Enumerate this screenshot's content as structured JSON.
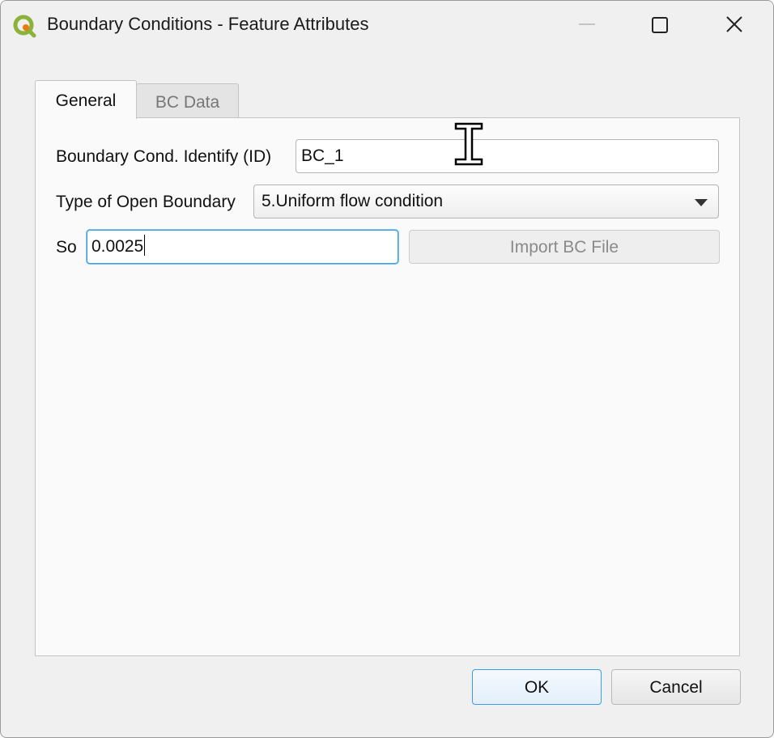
{
  "window": {
    "title": "Boundary Conditions - Feature Attributes",
    "app_icon": "qgis-logo-icon",
    "controls": {
      "minimize": "minimize-icon",
      "maximize": "maximize-icon",
      "close": "close-icon"
    }
  },
  "tabs": [
    {
      "label": "General",
      "active": true
    },
    {
      "label": "BC Data",
      "active": false
    }
  ],
  "form": {
    "id_label": "Boundary Cond. Identify (ID)",
    "id_value": "BC_1",
    "boundary_type_label": "Type of Open Boundary",
    "boundary_type_value": "5.Uniform flow condition",
    "so_label": "So",
    "so_value": "0.0025",
    "import_button_label": "Import BC File",
    "import_button_enabled": false
  },
  "buttons": {
    "ok_label": "OK",
    "cancel_label": "Cancel"
  },
  "colors": {
    "focus": "#3b9ee8",
    "qgis_green": "#8bb33a",
    "qgis_orange": "#ee7913"
  }
}
